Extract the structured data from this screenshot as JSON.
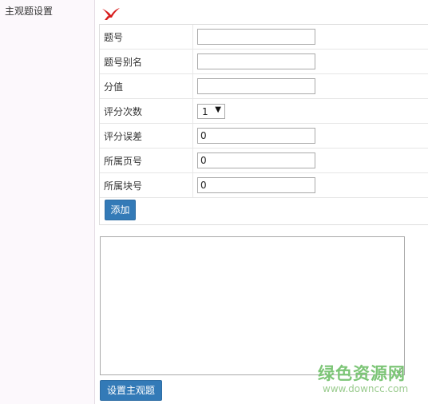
{
  "sidebar": {
    "title": "主观题设置"
  },
  "form": {
    "fields": [
      {
        "label": "题号",
        "value": ""
      },
      {
        "label": "题号别名",
        "value": ""
      },
      {
        "label": "分值",
        "value": ""
      },
      {
        "label": "评分次数",
        "value": "1"
      },
      {
        "label": "评分误差",
        "value": "0"
      },
      {
        "label": "所属页号",
        "value": "0"
      },
      {
        "label": "所属块号",
        "value": "0"
      }
    ],
    "add_label": "添加"
  },
  "textarea": {
    "value": ""
  },
  "submit_label": "设置主观题",
  "watermark": {
    "text": "绿色资源网",
    "url": "www.downcc.com"
  },
  "colors": {
    "button": "#337ab7",
    "close_icon": "#d81e1e",
    "sidebar_bg": "#fcf8fc",
    "watermark": "#7cc576"
  }
}
